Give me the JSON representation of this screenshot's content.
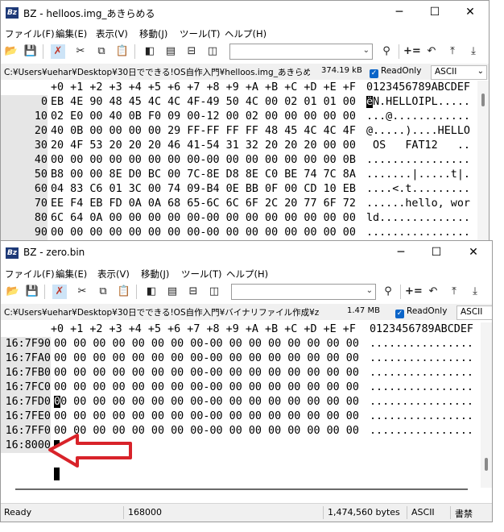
{
  "win1": {
    "title": "BZ - helloos.img_あきらめる",
    "app_icon": "Bz",
    "controls": {
      "min": "─",
      "max": "☐",
      "close": "✕"
    },
    "menu": [
      "ファイル(F)",
      "編集(E)",
      "表示(V)",
      "移動(J)",
      "ツール(T)",
      "ヘルプ(H)"
    ],
    "path": "C:¥Users¥uehar¥Desktop¥30日でできる!OS自作入門¥helloos.img_あきらめる",
    "size": "374.19 kB",
    "readonly": "ReadOnly",
    "encoding": "ASCII",
    "header": {
      "addr": "",
      "bytes": "+0 +1 +2 +3 +4 +5 +6 +7 +8 +9 +A +B +C +D +E +F",
      "ascii": "0123456789ABCDEF"
    },
    "rows": [
      {
        "addr": "0",
        "bytes": "EB 4E 90 48 45 4C 4C 4F-49 50 4C 00 02 01 01 00",
        "ascii_cursor": "ë",
        "ascii": "N.HELLOIPL....."
      },
      {
        "addr": "10",
        "bytes": "02 E0 00 40 0B F0 09 00-12 00 02 00 00 00 00 00",
        "ascii_cursor": "",
        "ascii": "...@............"
      },
      {
        "addr": "20",
        "bytes": "40 0B 00 00 00 00 29 FF-FF FF FF 48 45 4C 4C 4F",
        "ascii_cursor": "",
        "ascii": "@.....)....HELLO"
      },
      {
        "addr": "30",
        "bytes": "20 4F 53 20 20 20 46 41-54 31 32 20 20 20 00 00",
        "ascii_cursor": "",
        "ascii": " OS   FAT12   .."
      },
      {
        "addr": "40",
        "bytes": "00 00 00 00 00 00 00 00-00 00 00 00 00 00 00 0B",
        "ascii_cursor": "",
        "ascii": "................"
      },
      {
        "addr": "50",
        "bytes": "B8 00 00 8E D0 BC 00 7C-8E D8 8E C0 BE 74 7C 8A",
        "ascii_cursor": "",
        "ascii": ".......|.....t|."
      },
      {
        "addr": "60",
        "bytes": "04 83 C6 01 3C 00 74 09-B4 0E BB 0F 00 CD 10 EB",
        "ascii_cursor": "",
        "ascii": "....<.t........."
      },
      {
        "addr": "70",
        "bytes": "EE F4 EB FD 0A 0A 68 65-6C 6C 6F 2C 20 77 6F 72",
        "ascii_cursor": "",
        "ascii": "......hello, wor"
      },
      {
        "addr": "80",
        "bytes": "6C 64 0A 00 00 00 00 00-00 00 00 00 00 00 00 00",
        "ascii_cursor": "",
        "ascii": "ld.............."
      },
      {
        "addr": "90",
        "bytes": "00 00 00 00 00 00 00 00-00 00 00 00 00 00 00 00",
        "ascii_cursor": "",
        "ascii": "................"
      }
    ]
  },
  "win2": {
    "title": "BZ - zero.bin",
    "app_icon": "Bz",
    "controls": {
      "min": "─",
      "max": "☐",
      "close": "✕"
    },
    "menu": [
      "ファイル(F)",
      "編集(E)",
      "表示(V)",
      "移動(J)",
      "ツール(T)",
      "ヘルプ(H)"
    ],
    "path": "C:¥Users¥uehar¥Desktop¥30日でできる!OS自作入門¥バイナリファイル作成¥zero.",
    "size": "1.47 MB",
    "readonly": "ReadOnly",
    "encoding": "ASCII",
    "header": {
      "addr": "",
      "bytes": "+0 +1 +2 +3 +4 +5 +6 +7 +8 +9 +A +B +C +D +E +F",
      "ascii": "0123456789ABCDEF"
    },
    "rows": [
      {
        "addr": "16:7F90",
        "bytes_cursor": "",
        "bytes": "00 00 00 00 00 00 00 00-00 00 00 00 00 00 00 00",
        "ascii": "................"
      },
      {
        "addr": "16:7FA0",
        "bytes_cursor": "",
        "bytes": "00 00 00 00 00 00 00 00-00 00 00 00 00 00 00 00",
        "ascii": "................"
      },
      {
        "addr": "16:7FB0",
        "bytes_cursor": "",
        "bytes": "00 00 00 00 00 00 00 00-00 00 00 00 00 00 00 00",
        "ascii": "................"
      },
      {
        "addr": "16:7FC0",
        "bytes_cursor": "",
        "bytes": "00 00 00 00 00 00 00 00-00 00 00 00 00 00 00 00",
        "ascii": "................"
      },
      {
        "addr": "16:7FD0",
        "bytes_cursor": "0",
        "bytes": "0 00 00 00 00 00 00 00-00 00 00 00 00 00 00 00",
        "ascii": "................"
      },
      {
        "addr": "16:7FE0",
        "bytes_cursor": "",
        "bytes": "00 00 00 00 00 00 00 00-00 00 00 00 00 00 00 00",
        "ascii": "................"
      },
      {
        "addr": "16:7FF0",
        "bytes_cursor": "",
        "bytes": "00 00 00 00 00 00 00 00-00 00 00 00 00 00 00 00",
        "ascii": "................"
      },
      {
        "addr": "16:8000",
        "bytes_cursor": "",
        "bytes": "",
        "ascii": ""
      }
    ],
    "status": {
      "state": "Ready",
      "offset": "168000",
      "total": "1,474,560 bytes",
      "enc": "ASCII",
      "mode": "書禁"
    }
  },
  "colors": {
    "annotation_arrow": "#d8232a",
    "address_bg": "#e6e6e6",
    "checkbox": "#0a64c8"
  }
}
